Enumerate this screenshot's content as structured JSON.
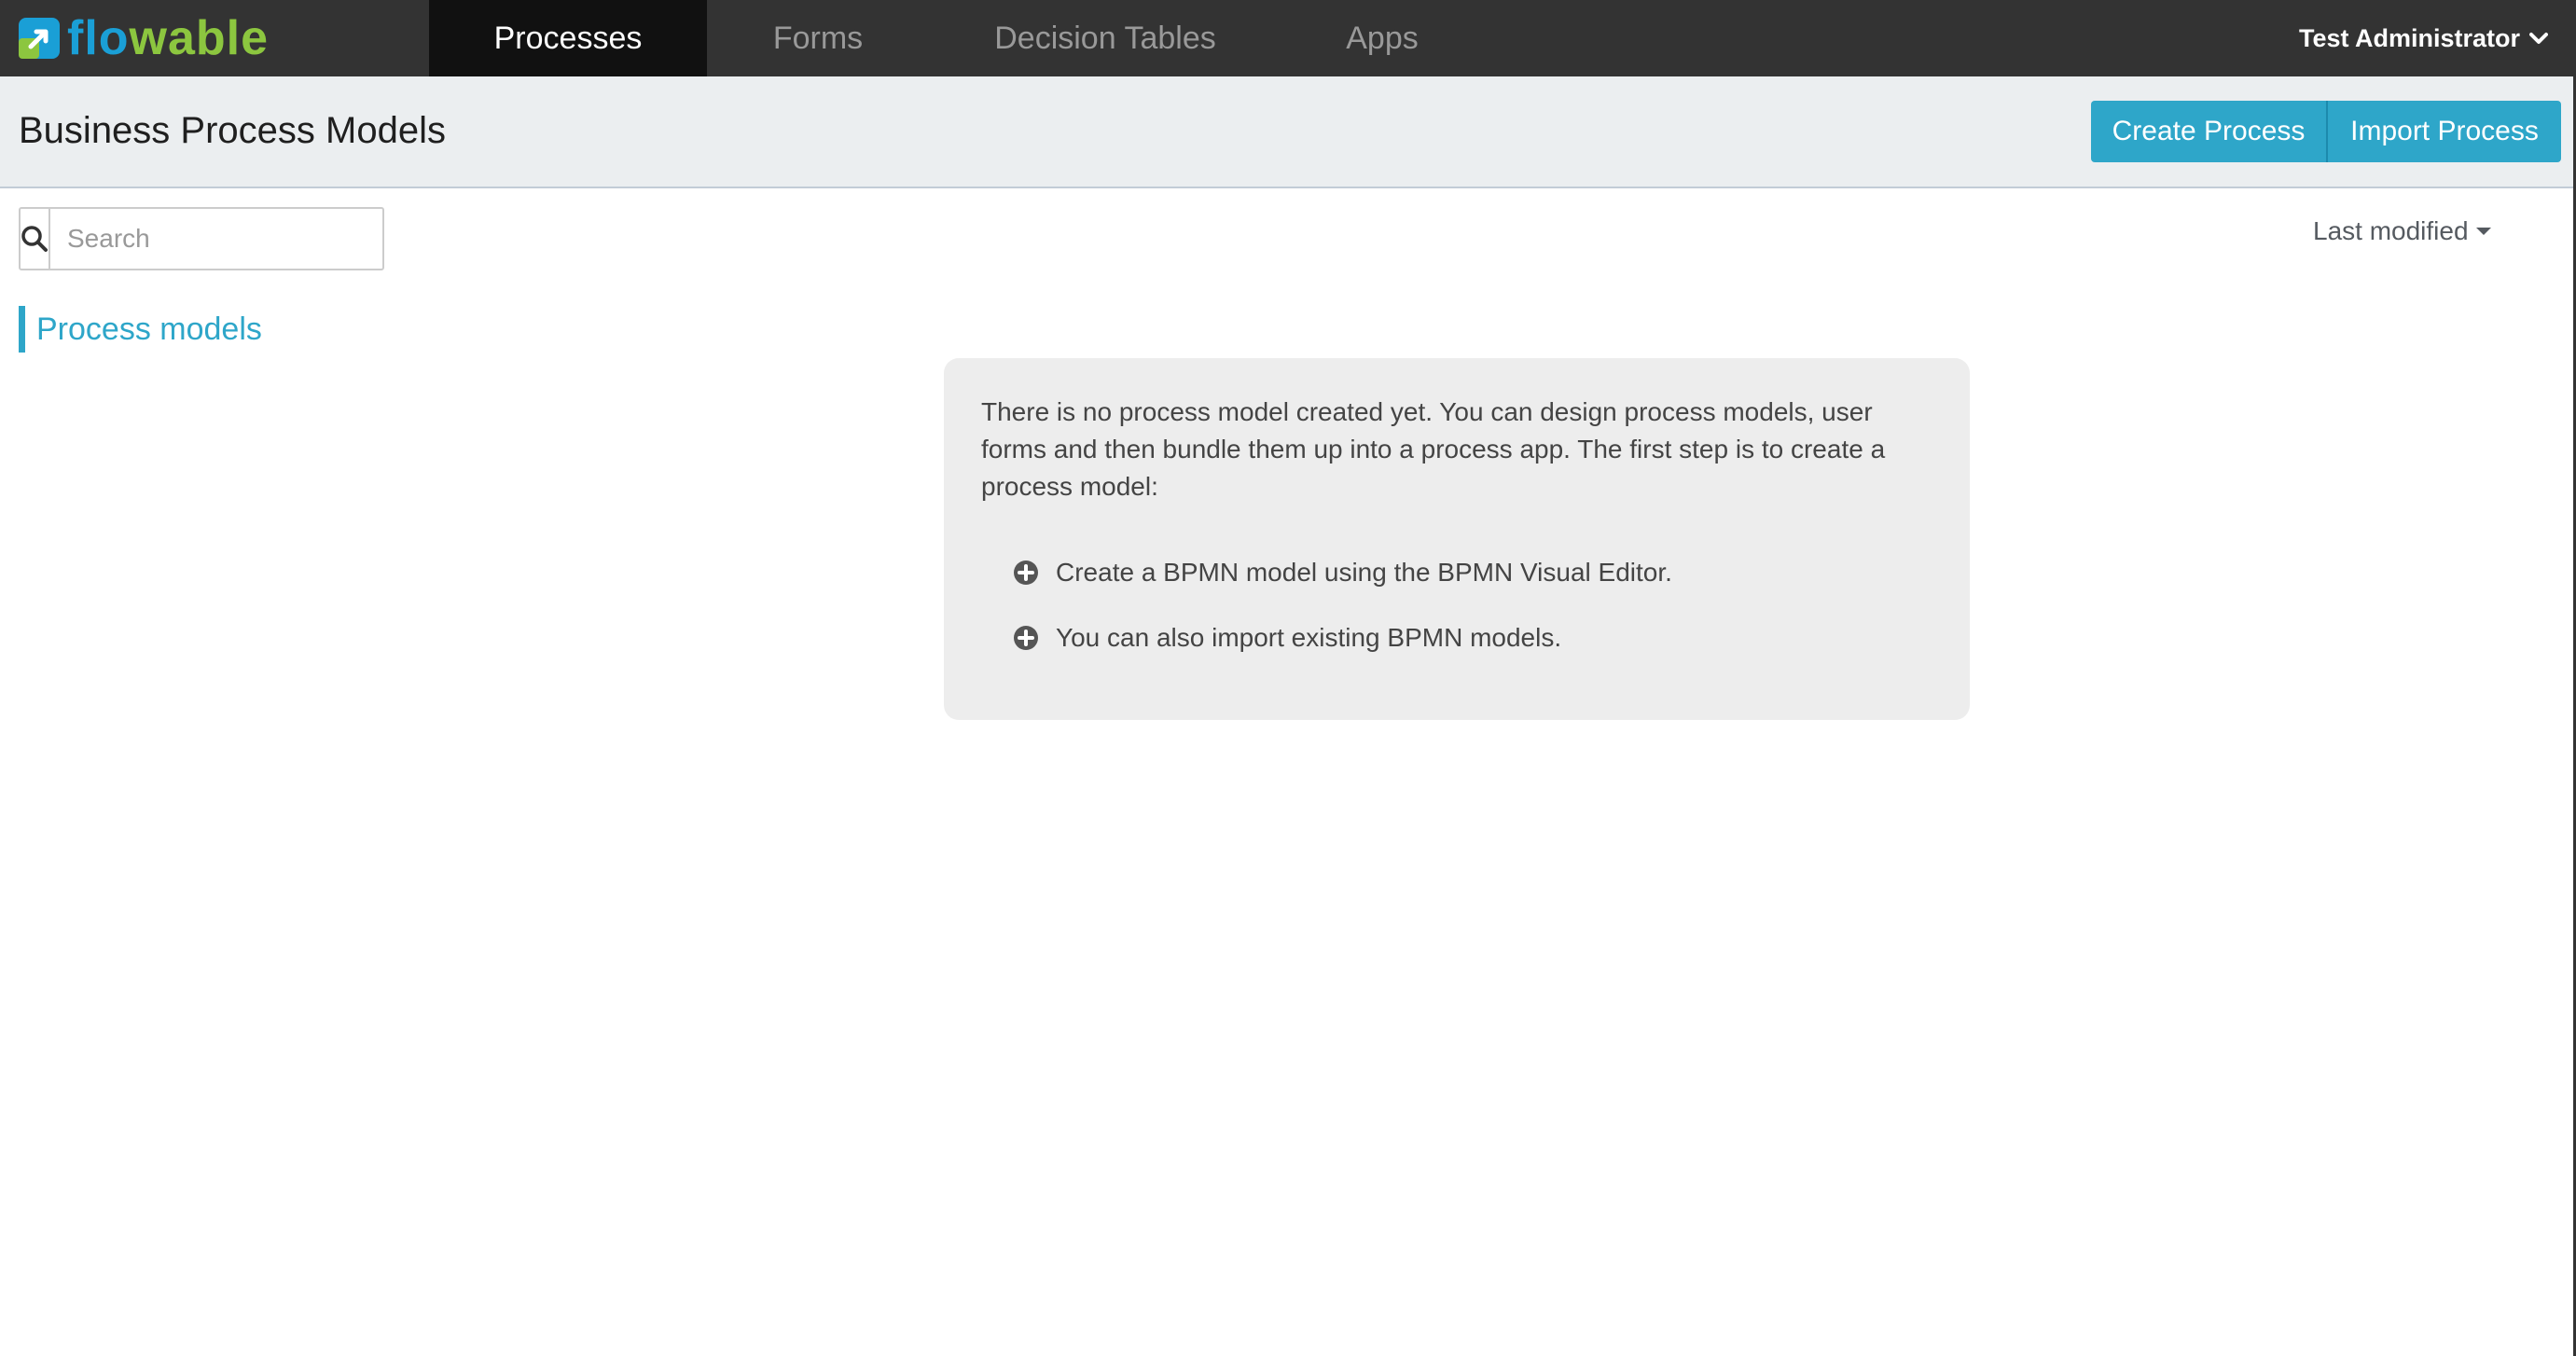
{
  "navbar": {
    "logo_text_part1": "flo",
    "logo_text_part2": "wable",
    "tabs": [
      {
        "label": "Processes",
        "active": true
      },
      {
        "label": "Forms",
        "active": false
      },
      {
        "label": "Decision Tables",
        "active": false
      },
      {
        "label": "Apps",
        "active": false
      }
    ],
    "user_name": "Test Administrator"
  },
  "header": {
    "title": "Business Process Models",
    "create_button": "Create Process",
    "import_button": "Import Process"
  },
  "search": {
    "placeholder": "Search",
    "value": ""
  },
  "sort": {
    "selected": "Last modified"
  },
  "filters": {
    "items": [
      {
        "label": "Process models",
        "active": true
      }
    ]
  },
  "empty_state": {
    "message": "There is no process model created yet. You can design process models, user forms and then bundle them up into a process app. The first step is to create a process model:",
    "actions": [
      {
        "label": "Create a BPMN model using the BPMN Visual Editor.",
        "icon": "plus-circle-icon"
      },
      {
        "label": "You can also import existing BPMN models.",
        "icon": "plus-circle-icon"
      }
    ]
  },
  "colors": {
    "navbar_bg": "#333333",
    "active_tab_bg": "#111111",
    "accent": "#2ea6c9",
    "logo_blue": "#1a9fd6",
    "logo_green": "#8cc63f",
    "subheader_bg": "#ebeef0",
    "empty_box_bg": "#ededed"
  }
}
